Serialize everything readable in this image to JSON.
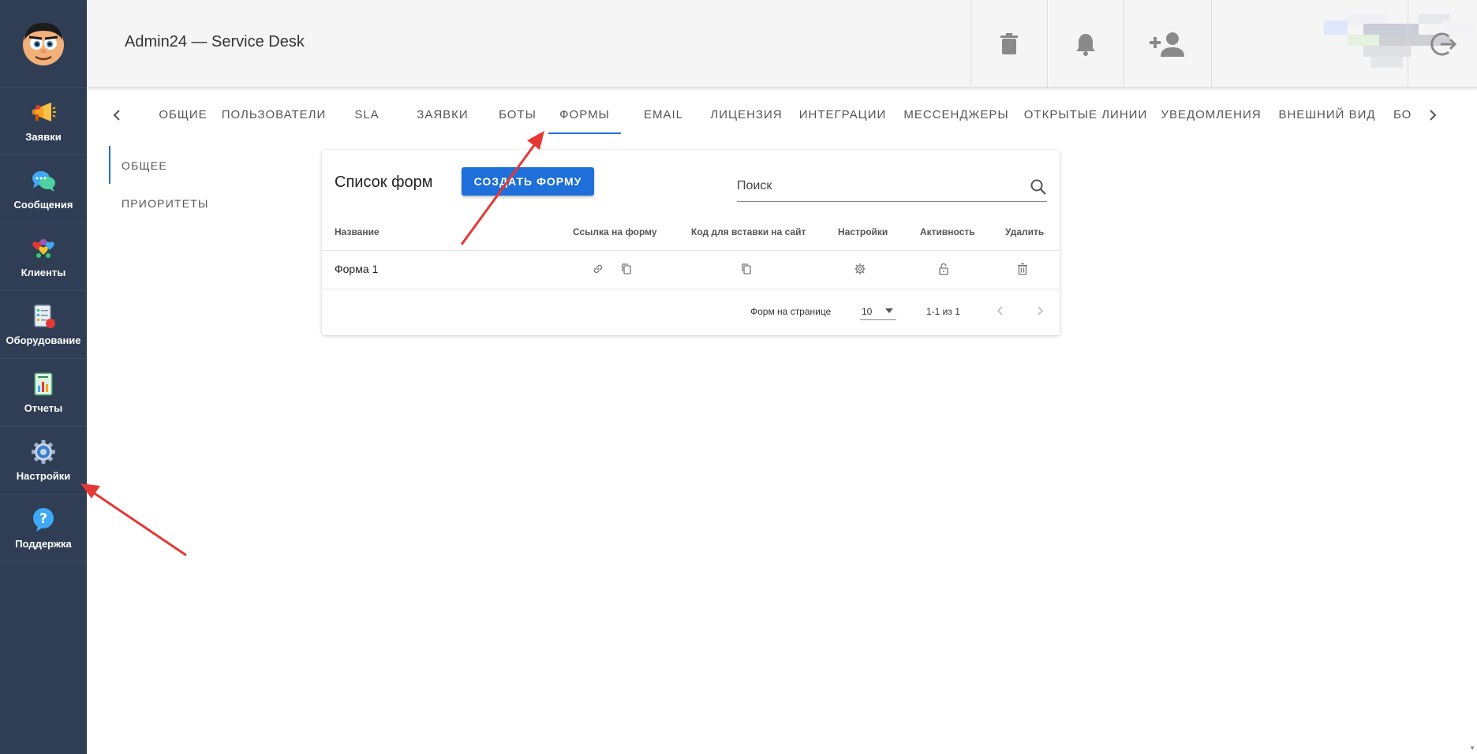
{
  "app_title": "Admin24 — Service Desk",
  "sidebar": {
    "items": [
      {
        "label": "Заявки",
        "icon": "megaphone-icon"
      },
      {
        "label": "Сообщения",
        "icon": "chat-bubbles-icon"
      },
      {
        "label": "Клиенты",
        "icon": "clients-hearts-icon"
      },
      {
        "label": "Оборудование",
        "icon": "equipment-checklist-icon"
      },
      {
        "label": "Отчеты",
        "icon": "report-chart-icon"
      },
      {
        "label": "Настройки",
        "icon": "gear-icon"
      },
      {
        "label": "Поддержка",
        "icon": "help-bubble-icon"
      }
    ]
  },
  "header": {
    "icons": [
      "trash-icon",
      "bell-icon",
      "add-user-icon",
      "logout-icon"
    ]
  },
  "tabs": [
    "Общие",
    "Пользователи",
    "SLA",
    "Заявки",
    "Боты",
    "Формы",
    "Email",
    "Лицензия",
    "Интеграции",
    "Мессенджеры",
    "Открытые линии",
    "Уведомления",
    "Внешний вид",
    "Бо"
  ],
  "active_tab": "Формы",
  "subnav": [
    "Общее",
    "Приоритеты"
  ],
  "card": {
    "title": "Список форм",
    "create_button": "Создать форму",
    "search_placeholder": "Поиск",
    "columns": [
      "Название",
      "Ссылка на форму",
      "Код для вставки на сайт",
      "Настройки",
      "Активность",
      "Удалить"
    ],
    "rows": [
      {
        "name": "Форма 1"
      }
    ],
    "footer": {
      "per_page_label": "Форм на странице",
      "per_page_value": "10",
      "range": "1-1 из 1"
    }
  },
  "colors": {
    "sidebar_bg": "#2f3e55",
    "accent": "#1e6fd9",
    "annotation_arrow": "#e53935",
    "header_bg": "#f5f5f5"
  }
}
